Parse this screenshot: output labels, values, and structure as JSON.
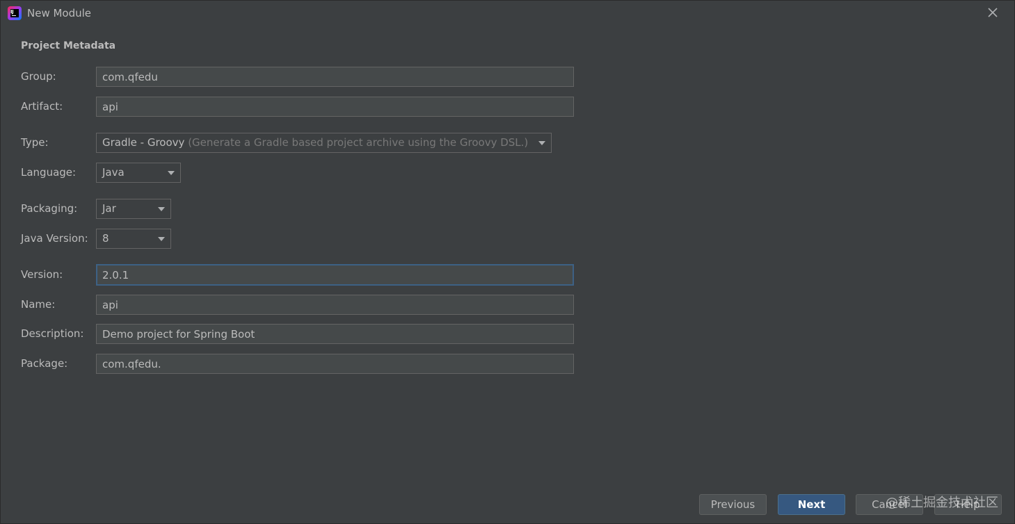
{
  "window": {
    "title": "New Module",
    "logo_text": "IJ",
    "close_icon": "close-icon"
  },
  "section": {
    "title": "Project Metadata"
  },
  "form": {
    "group": {
      "label": "Group:",
      "value": "com.qfedu"
    },
    "artifact": {
      "label": "Artifact:",
      "value": "api"
    },
    "type": {
      "label": "Type:",
      "value": "Gradle - Groovy",
      "hint": "(Generate a Gradle based project archive using the Groovy DSL.)"
    },
    "language": {
      "label": "Language:",
      "value": "Java"
    },
    "packaging": {
      "label": "Packaging:",
      "value": "Jar"
    },
    "java_version": {
      "label": "Java Version:",
      "value": "8"
    },
    "version": {
      "label": "Version:",
      "value": "2.0.1"
    },
    "name": {
      "label": "Name:",
      "value": "api"
    },
    "description": {
      "label": "Description:",
      "value": "Demo project for Spring Boot"
    },
    "package": {
      "label": "Package:",
      "value": "com.qfedu."
    }
  },
  "buttons": {
    "previous": "Previous",
    "next": "Next",
    "cancel": "Cancel",
    "help": "Help"
  },
  "watermark": "@稀土掘金技术社区",
  "colors": {
    "background": "#3c3f41",
    "primary_button": "#365880",
    "focus_border": "#3d6185"
  }
}
